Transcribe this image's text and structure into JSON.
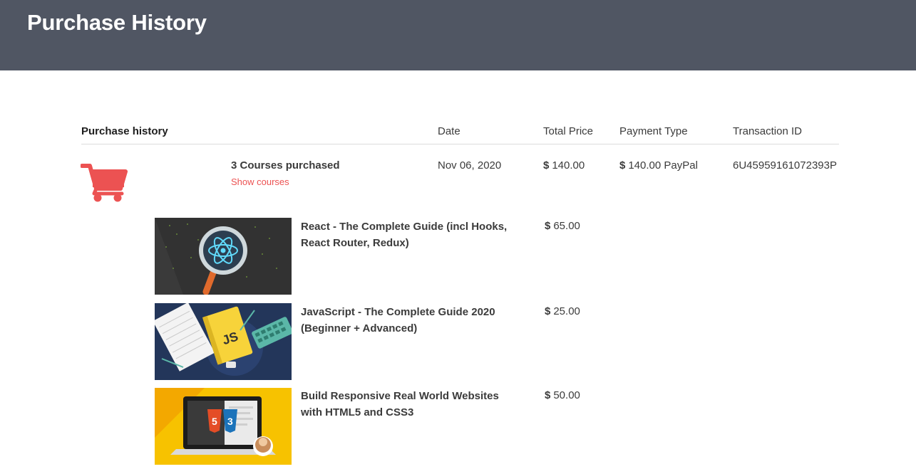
{
  "header": {
    "title": "Purchase History"
  },
  "table": {
    "columns": [
      "Purchase history",
      "Date",
      "Total Price",
      "Payment Type",
      "Transaction ID"
    ]
  },
  "purchase": {
    "summary": "3 Courses purchased",
    "show_link": "Show courses",
    "date": "Nov 06, 2020",
    "currency": "$",
    "total": "140.00",
    "payment": "140.00 PayPal",
    "transaction_id": "6U45959161072393P",
    "icon": "shopping-cart-icon",
    "accent_color": "#ec5252"
  },
  "courses": [
    {
      "title": "React - The Complete Guide (incl Hooks, React Router, Redux)",
      "price": "65.00",
      "thumb_logo": ""
    },
    {
      "title": "JavaScript - The Complete Guide 2020 (Beginner + Advanced)",
      "price": "25.00",
      "thumb_logo": "JS"
    },
    {
      "title": "Build Responsive Real World Websites with HTML5 and CSS3",
      "price": "50.00",
      "thumb_logo": ""
    }
  ],
  "colors": {
    "header_bg": "#505663",
    "text": "#3b3b3b",
    "link": "#ec5252"
  }
}
